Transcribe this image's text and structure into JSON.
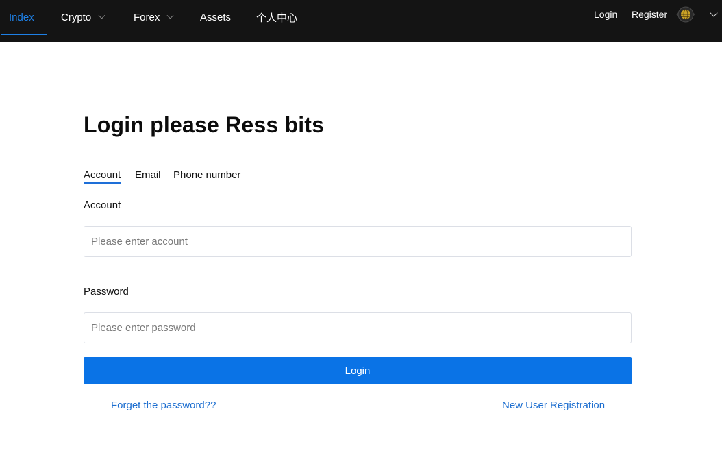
{
  "nav": {
    "items": [
      {
        "label": "Index",
        "active": true
      },
      {
        "label": "Crypto",
        "has_dropdown": true
      },
      {
        "label": "Forex",
        "has_dropdown": true
      },
      {
        "label": "Assets"
      },
      {
        "label": "个人中心"
      }
    ],
    "login_label": "Login",
    "register_label": "Register",
    "language_icon": "globe-icon"
  },
  "main": {
    "title": "Login please Ress bits",
    "tabs": [
      {
        "label": "Account",
        "active": true
      },
      {
        "label": "Email"
      },
      {
        "label": "Phone number"
      }
    ],
    "account_label": "Account",
    "account_placeholder": "Please enter account",
    "account_value": "",
    "password_label": "Password",
    "password_placeholder": "Please enter password",
    "password_value": "",
    "login_button": "Login",
    "forget_link": "Forget the password??",
    "register_link": "New User Registration"
  },
  "colors": {
    "accent": "#0a73e6",
    "nav_background": "#141414",
    "link": "#1e6fd0"
  }
}
